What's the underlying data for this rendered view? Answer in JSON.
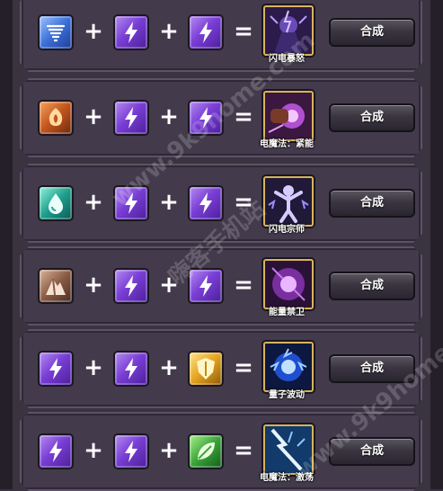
{
  "recipes": [
    {
      "ingredients": [
        "tornado-icon",
        "lightning-icon",
        "lightning-icon"
      ],
      "ingredient_colors": [
        "blue",
        "purple",
        "purple"
      ],
      "result": "闪电暴怒",
      "result_icon": "thunder-demon-icon",
      "button": "合成"
    },
    {
      "ingredients": [
        "fire-claw-icon",
        "lightning-icon",
        "lightning-icon"
      ],
      "ingredient_colors": [
        "orange",
        "purple",
        "purple"
      ],
      "result": "电魔法：紧能",
      "result_icon": "energy-fist-icon",
      "button": "合成"
    },
    {
      "ingredients": [
        "water-drop-icon",
        "lightning-icon",
        "lightning-icon"
      ],
      "ingredient_colors": [
        "teal",
        "purple",
        "purple"
      ],
      "result": "闪电宗师",
      "result_icon": "storm-master-icon",
      "button": "合成"
    },
    {
      "ingredients": [
        "mountain-icon",
        "lightning-icon",
        "lightning-icon"
      ],
      "ingredient_colors": [
        "brown",
        "purple",
        "purple"
      ],
      "result": "能量禁卫",
      "result_icon": "energy-guard-icon",
      "button": "合成"
    },
    {
      "ingredients": [
        "lightning-icon",
        "lightning-icon",
        "shield-icon"
      ],
      "ingredient_colors": [
        "purple",
        "purple",
        "gold"
      ],
      "result": "量子波动",
      "result_icon": "quantum-wave-icon",
      "button": "合成"
    },
    {
      "ingredients": [
        "lightning-icon",
        "lightning-icon",
        "leaf-icon"
      ],
      "ingredient_colors": [
        "purple",
        "purple",
        "green"
      ],
      "result": "电魔法：激荡",
      "result_icon": "lightning-strike-icon",
      "button": "合成"
    }
  ],
  "operators": {
    "plus": "+",
    "equals": "="
  },
  "watermarks": [
    "www.9k9home.com",
    "嗨客手机站",
    "www.9k9home.com"
  ],
  "colors": {
    "panel": "#433a4c",
    "border": "#5d5267",
    "result_border": "#d8b35a"
  }
}
